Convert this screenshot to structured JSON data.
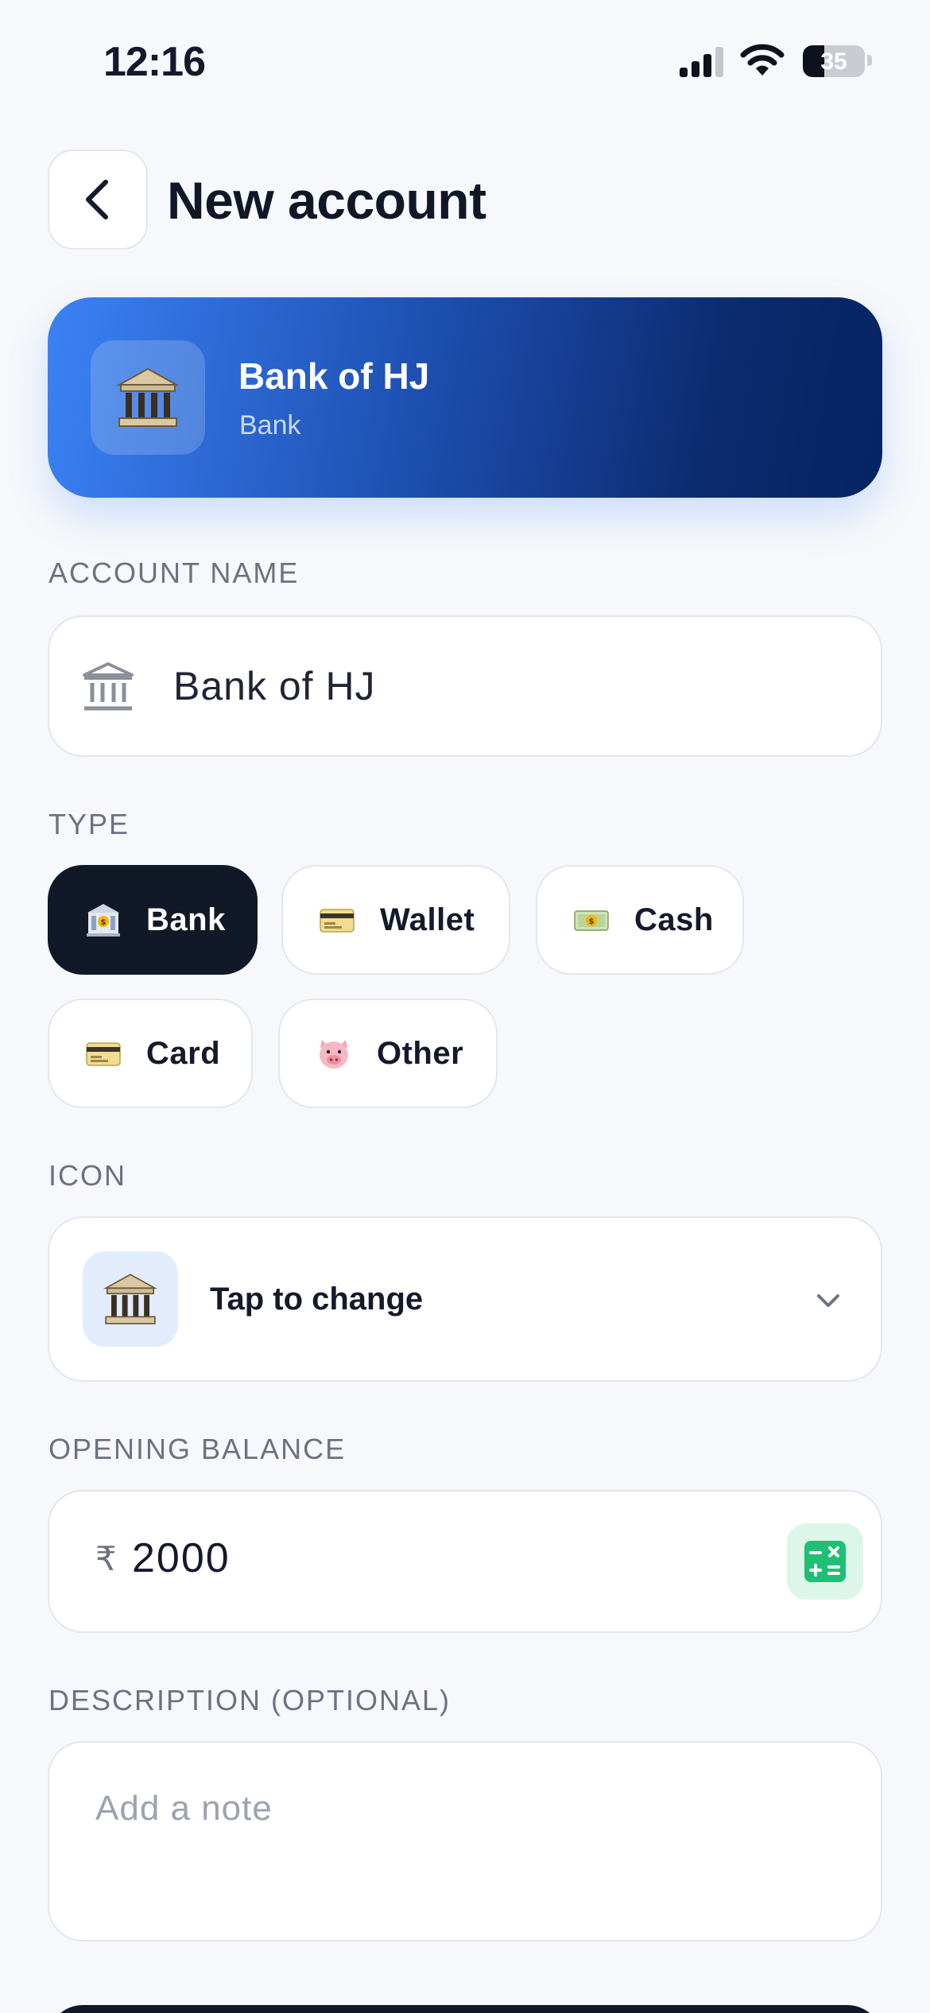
{
  "status_bar": {
    "time": "12:16",
    "battery": "35",
    "battery_level": 0.35
  },
  "header": {
    "title": "New account",
    "back_icon": "chevron-left-icon"
  },
  "preview": {
    "name": "Bank of HJ",
    "type": "Bank",
    "icon": "bank-icon"
  },
  "account_name": {
    "label": "ACCOUNT NAME",
    "value": "Bank of HJ",
    "icon": "bank-outline-icon"
  },
  "type": {
    "label": "TYPE",
    "options": [
      {
        "label": "Bank",
        "icon": "bank-building-icon",
        "selected": true
      },
      {
        "label": "Wallet",
        "icon": "credit-card-icon",
        "selected": false
      },
      {
        "label": "Cash",
        "icon": "banknote-icon",
        "selected": false
      },
      {
        "label": "Card",
        "icon": "credit-card-icon",
        "selected": false
      },
      {
        "label": "Other",
        "icon": "pig-face-icon",
        "selected": false
      }
    ]
  },
  "icon_picker": {
    "label": "ICON",
    "hint": "Tap to change",
    "icon": "bank-icon"
  },
  "opening_balance": {
    "label": "OPENING BALANCE",
    "currency": "₹",
    "value": "2000"
  },
  "description": {
    "label": "DESCRIPTION (OPTIONAL)",
    "placeholder": "Add a note",
    "value": ""
  },
  "colors": {
    "accent": "#3b82f6",
    "accent_dark": "#062462",
    "primary": "#111827",
    "calc_green": "#1fbf75",
    "background": "#f7f8fb"
  }
}
